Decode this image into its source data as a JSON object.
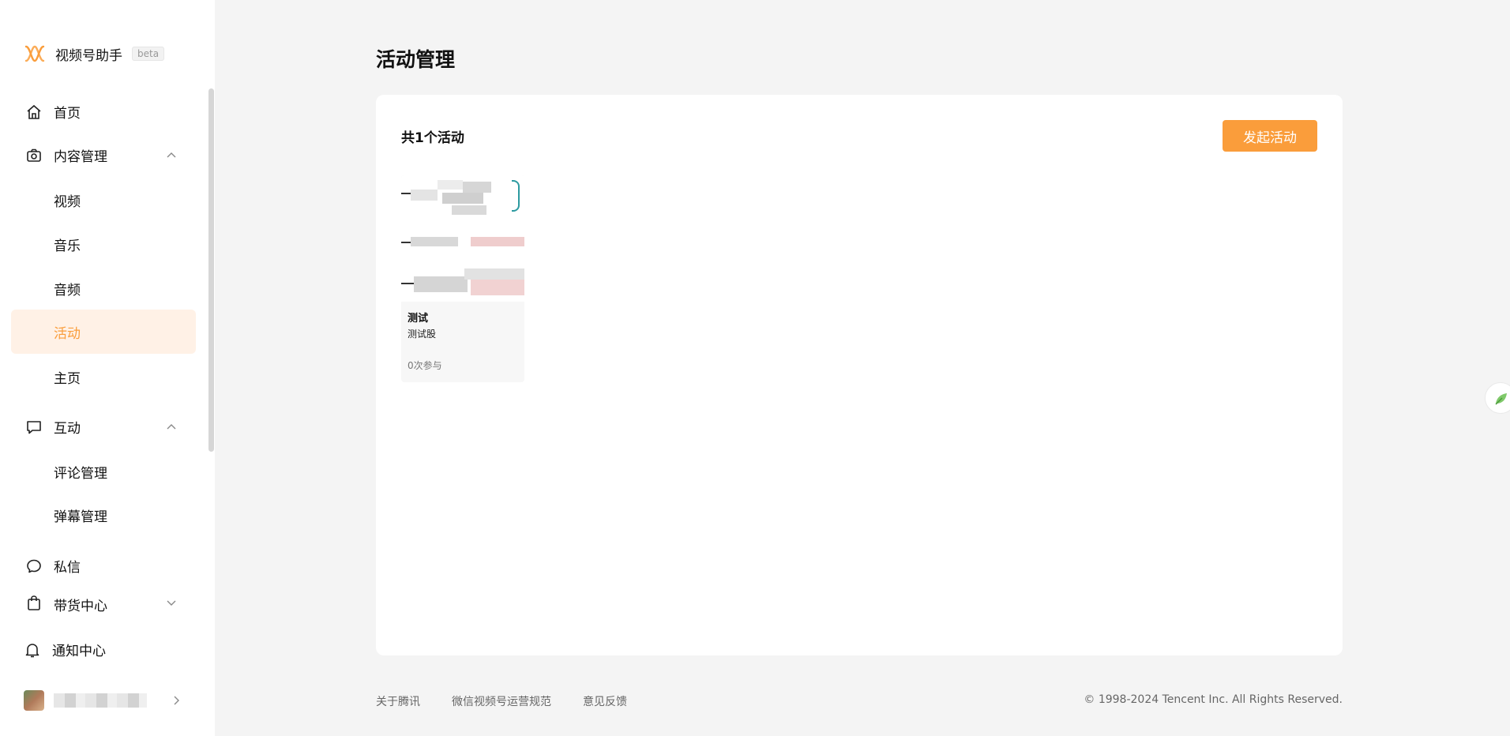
{
  "brand": {
    "name": "视频号助手",
    "badge": "beta",
    "logo_icon": "wave-logo-icon"
  },
  "sidebar": {
    "items": [
      {
        "label": "首页",
        "icon": "home-icon"
      },
      {
        "label": "内容管理",
        "icon": "camera-icon",
        "expanded": true
      },
      {
        "label": "视频"
      },
      {
        "label": "音乐"
      },
      {
        "label": "音频"
      },
      {
        "label": "活动",
        "active": true
      },
      {
        "label": "主页"
      },
      {
        "label": "互动",
        "icon": "chat-icon",
        "expanded": true
      },
      {
        "label": "评论管理"
      },
      {
        "label": "弹幕管理"
      },
      {
        "label": "私信",
        "icon": "message-icon"
      },
      {
        "label": "带货中心",
        "icon": "bag-icon",
        "expanded": false
      }
    ],
    "notification": {
      "label": "通知中心",
      "icon": "bell-icon"
    }
  },
  "main": {
    "title": "活动管理",
    "count_label": "共1个活动",
    "launch_button": "发起活动",
    "activities": [
      {
        "title": "测试",
        "desc": "测试股",
        "participants": "0次参与"
      }
    ]
  },
  "footer": {
    "links": [
      "关于腾讯",
      "微信视频号运营规范",
      "意见反馈"
    ],
    "copyright": "© 1998-2024 Tencent Inc. All Rights Reserved."
  },
  "colors": {
    "accent": "#fa9d3b",
    "active_bg": "#fff1e6",
    "page_bg": "#f4f4f4"
  }
}
